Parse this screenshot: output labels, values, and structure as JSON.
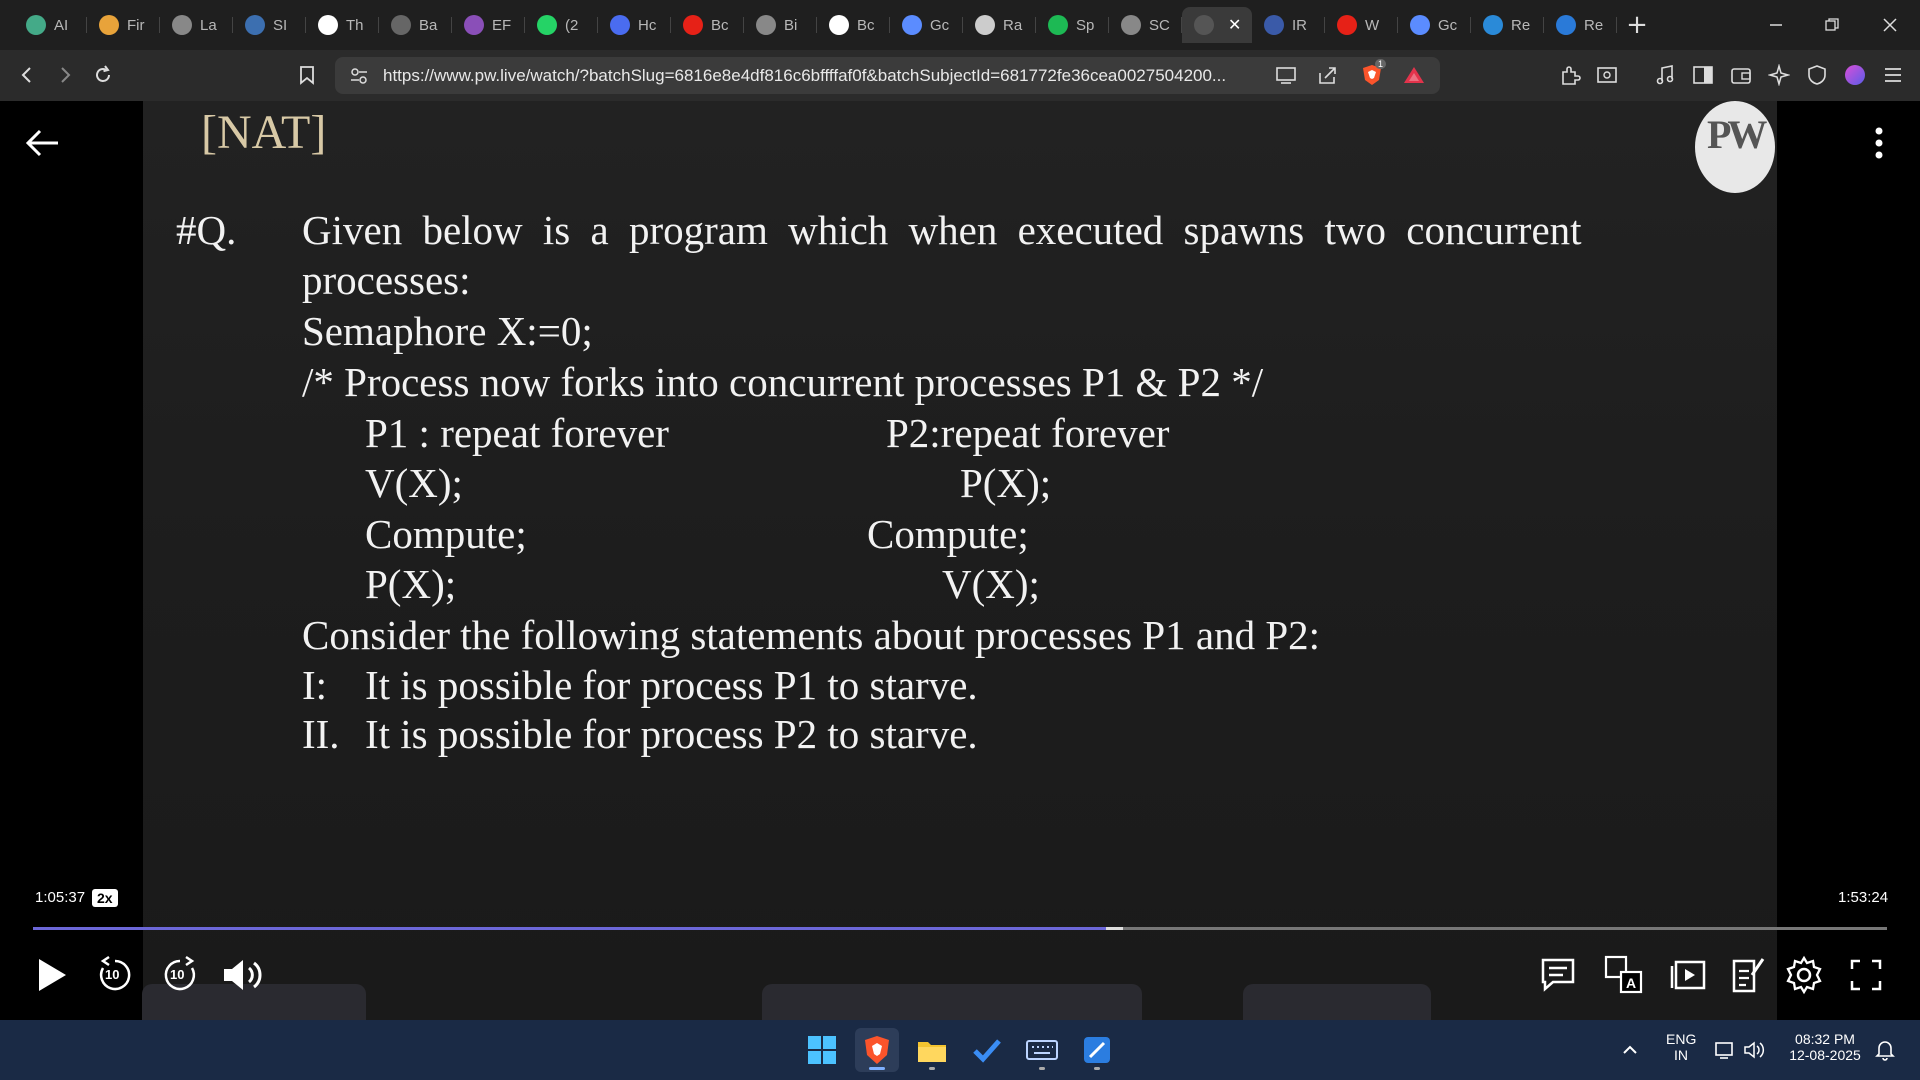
{
  "browser": {
    "tabs": [
      {
        "label": "AI",
        "icon": "chatgpt-icon",
        "color": "#4a8"
      },
      {
        "label": "Fir",
        "icon": "fire-icon",
        "color": "#e8a33a"
      },
      {
        "label": "La",
        "icon": "globe-icon",
        "color": "#888"
      },
      {
        "label": "SI",
        "icon": "docs-icon",
        "color": "#3c6fb0"
      },
      {
        "label": "Th",
        "icon": "w3schools-icon",
        "color": "#fff"
      },
      {
        "label": "Ba",
        "icon": "keyboard-icon",
        "color": "#666"
      },
      {
        "label": "EF",
        "icon": "brain-icon",
        "color": "#8a4fb8"
      },
      {
        "label": "(2",
        "icon": "whatsapp-icon",
        "color": "#25d366"
      },
      {
        "label": "Hc",
        "icon": "bookmark-blue-icon",
        "color": "#4a6cf0"
      },
      {
        "label": "Bc",
        "icon": "youtube-icon",
        "color": "#e62117"
      },
      {
        "label": "Bi",
        "icon": "ortho-icon",
        "color": "#888"
      },
      {
        "label": "Bc",
        "icon": "google-icon",
        "color": "#fff"
      },
      {
        "label": "Gc",
        "icon": "gemini-icon",
        "color": "#5b8cff"
      },
      {
        "label": "Ra",
        "icon": "openai-icon",
        "color": "#ccc"
      },
      {
        "label": "Sp",
        "icon": "spotify-icon",
        "color": "#1db954"
      },
      {
        "label": "SC",
        "icon": "globe-icon",
        "color": "#888"
      },
      {
        "label": "",
        "icon": "pw-icon",
        "color": "#555",
        "active": true
      },
      {
        "label": "IR",
        "icon": "irctc-icon",
        "color": "#3a5aa8"
      },
      {
        "label": "W",
        "icon": "youtube-icon",
        "color": "#e62117"
      },
      {
        "label": "Gc",
        "icon": "gemini-icon",
        "color": "#5b8cff"
      },
      {
        "label": "Re",
        "icon": "screen-icon",
        "color": "#2a8ad8"
      },
      {
        "label": "Re",
        "icon": "store-icon",
        "color": "#2a7ad8"
      }
    ],
    "url": "https://www.pw.live/watch/?batchSlug=6816e8e4df816c6bffffaf0f&batchSubjectId=681772fe36cea0027504200...",
    "shield_count": "1"
  },
  "video": {
    "tag": "[NAT]",
    "q_label": "#Q.",
    "lines": {
      "l1": "Given below is a program which when executed spawns two concurrent",
      "l2": "processes:",
      "l3": "Semaphore X:=0;",
      "l4": "/* Process now forks into concurrent processes P1 & P2 */",
      "p1_head": "P1 : repeat forever",
      "p2_head": "P2:repeat forever",
      "p1_a": "V(X);",
      "p2_a": "P(X);",
      "p1_b": "Compute;",
      "p2_b": "Compute;",
      "p1_c": "P(X);",
      "p2_c": "V(X);",
      "l5": "Consider the following statements about processes P1 and P2:",
      "s1_num": "I:",
      "s1": "It is possible for process P1 to starve.",
      "s2_num": "II.",
      "s2": "It is possible for process P2 to starve."
    },
    "logo": "PW",
    "current_time": "1:05:37",
    "speed": "2x",
    "duration": "1:53:24",
    "progress_fraction": 0.579,
    "buffer_fraction": 0.588,
    "skip_back": "10",
    "skip_forward": "10",
    "accent_color": "#6c67d8"
  },
  "taskbar": {
    "lang_top": "ENG",
    "lang_bottom": "IN",
    "time": "08:32 PM",
    "date": "12-08-2025"
  }
}
